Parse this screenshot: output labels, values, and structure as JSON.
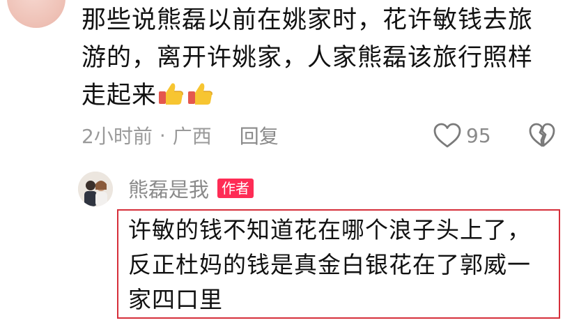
{
  "comment": {
    "text": "那些说熊磊以前在姚家时，花许敏钱去旅游的，离开许姚家，人家熊磊该旅行照样走起来",
    "emoji": [
      "thumbs-up",
      "thumbs-up"
    ],
    "time": "2小时前",
    "separator": "·",
    "location": "广西",
    "reply_label": "回复",
    "likes": "95"
  },
  "reply": {
    "user_name": "熊磊是我",
    "badge": "作者",
    "text": "许敏的钱不知道花在哪个浪子头上了，反正杜妈的钱是真金白银花在了郭威一家四口里"
  },
  "icons": {
    "like": "heart-outline-icon",
    "dislike": "broken-heart-icon"
  },
  "colors": {
    "badge": "#fe2c55",
    "highlight_border": "#d62f3a",
    "meta_text": "#9a9a9a"
  }
}
